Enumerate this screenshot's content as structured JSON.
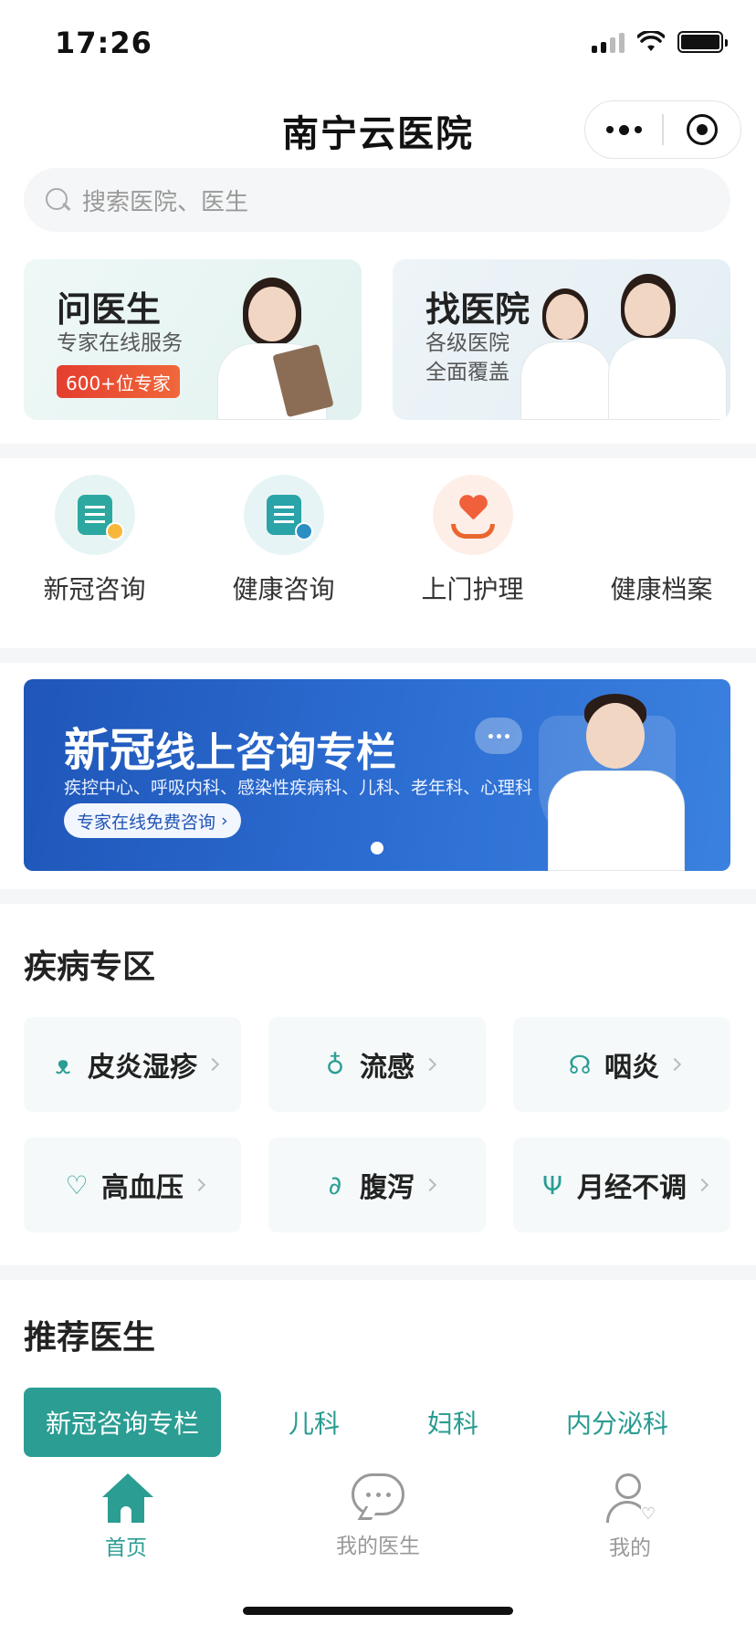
{
  "status_bar": {
    "time": "17:26"
  },
  "header": {
    "title": "南宁云医院"
  },
  "search": {
    "placeholder": "搜索医院、医生"
  },
  "hero_cards": [
    {
      "title": "问医生",
      "subtitle": "专家在线服务",
      "badge": "600+位专家"
    },
    {
      "title": "找医院",
      "subtitle_line1": "各级医院",
      "subtitle_line2": "全面覆盖"
    }
  ],
  "quick_services": [
    {
      "label": "新冠咨询",
      "icon": "document-badge-icon"
    },
    {
      "label": "健康咨询",
      "icon": "chart-lightning-icon"
    },
    {
      "label": "上门护理",
      "icon": "heart-hands-icon"
    },
    {
      "label": "健康档案",
      "icon": ""
    }
  ],
  "banner": {
    "title_big": "新冠",
    "title_rest": "线上咨询专栏",
    "subtitle": "疾控中心、呼吸内科、感染性疾病科、儿科、老年科、心理科",
    "button": "专家在线免费咨询",
    "button_arrow": "›"
  },
  "disease_section": {
    "title": "疾病专区",
    "items": [
      {
        "label": "皮炎湿疹",
        "icon": "skin-icon"
      },
      {
        "label": "流感",
        "icon": "flu-icon"
      },
      {
        "label": "咽炎",
        "icon": "throat-icon"
      },
      {
        "label": "高血压",
        "icon": "heart-pulse-icon"
      },
      {
        "label": "腹泻",
        "icon": "stomach-icon"
      },
      {
        "label": "月经不调",
        "icon": "uterus-icon"
      }
    ]
  },
  "recommend_section": {
    "title": "推荐医生",
    "tabs": [
      "新冠咨询专栏",
      "儿科",
      "妇科",
      "内分泌科"
    ],
    "active_tab": 0
  },
  "bottom_nav": {
    "items": [
      "首页",
      "我的医生",
      "我的"
    ],
    "active": 0
  },
  "colors": {
    "accent": "#2b9d93",
    "banner": "#2d6ed3",
    "badge": "#e43d2f"
  }
}
